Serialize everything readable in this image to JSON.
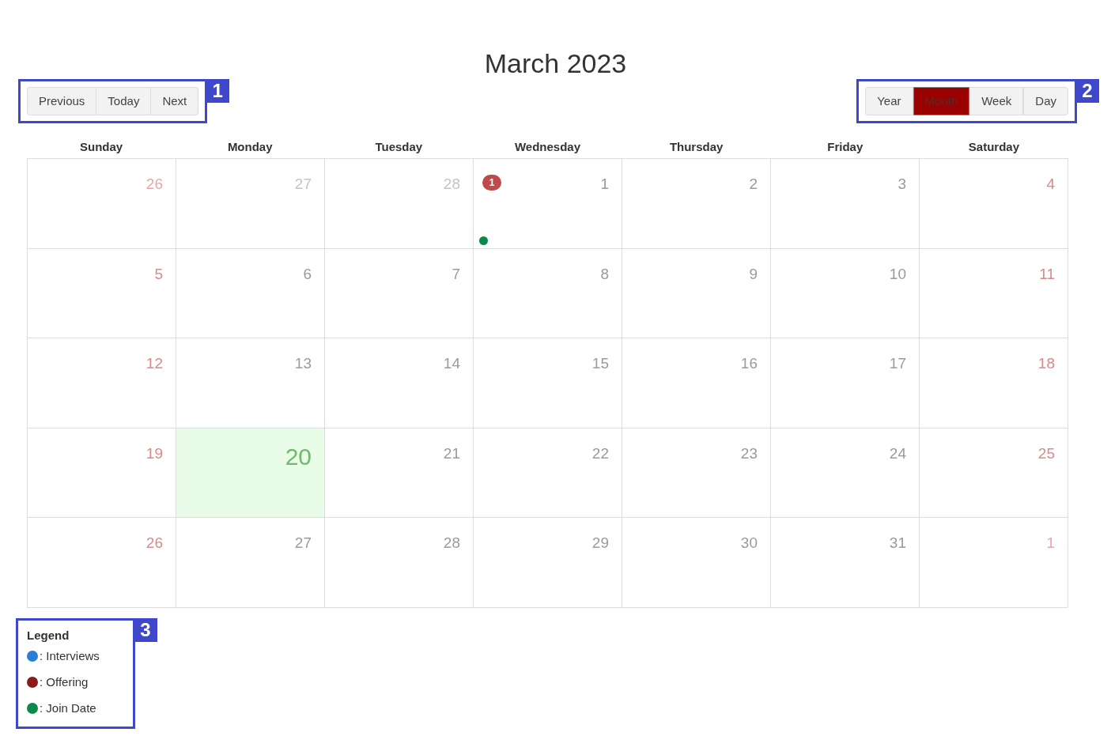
{
  "title": "March 2023",
  "nav_buttons": [
    {
      "label": "Previous"
    },
    {
      "label": "Today"
    },
    {
      "label": "Next"
    }
  ],
  "view_buttons": [
    {
      "label": "Year",
      "selected": false
    },
    {
      "label": "Month",
      "selected": true
    },
    {
      "label": "Week",
      "selected": false
    },
    {
      "label": "Day",
      "selected": false
    }
  ],
  "callouts": [
    "1",
    "2",
    "3"
  ],
  "weekdays": [
    "Sunday",
    "Monday",
    "Tuesday",
    "Wednesday",
    "Thursday",
    "Friday",
    "Saturday"
  ],
  "weeks": [
    [
      {
        "day": "26",
        "muted": true,
        "weekend": true
      },
      {
        "day": "27",
        "muted": true,
        "weekend": false
      },
      {
        "day": "28",
        "muted": true,
        "weekend": false
      },
      {
        "day": "1",
        "muted": false,
        "weekend": false,
        "badge": "1",
        "events": [
          {
            "color": "#0a8a4a"
          }
        ]
      },
      {
        "day": "2",
        "muted": false,
        "weekend": false
      },
      {
        "day": "3",
        "muted": false,
        "weekend": false
      },
      {
        "day": "4",
        "muted": false,
        "weekend": true
      }
    ],
    [
      {
        "day": "5",
        "muted": false,
        "weekend": true
      },
      {
        "day": "6",
        "muted": false,
        "weekend": false
      },
      {
        "day": "7",
        "muted": false,
        "weekend": false
      },
      {
        "day": "8",
        "muted": false,
        "weekend": false
      },
      {
        "day": "9",
        "muted": false,
        "weekend": false
      },
      {
        "day": "10",
        "muted": false,
        "weekend": false
      },
      {
        "day": "11",
        "muted": false,
        "weekend": true
      }
    ],
    [
      {
        "day": "12",
        "muted": false,
        "weekend": true
      },
      {
        "day": "13",
        "muted": false,
        "weekend": false
      },
      {
        "day": "14",
        "muted": false,
        "weekend": false
      },
      {
        "day": "15",
        "muted": false,
        "weekend": false
      },
      {
        "day": "16",
        "muted": false,
        "weekend": false
      },
      {
        "day": "17",
        "muted": false,
        "weekend": false
      },
      {
        "day": "18",
        "muted": false,
        "weekend": true
      }
    ],
    [
      {
        "day": "19",
        "muted": false,
        "weekend": true
      },
      {
        "day": "20",
        "today": true
      },
      {
        "day": "21",
        "muted": false,
        "weekend": false
      },
      {
        "day": "22",
        "muted": false,
        "weekend": false
      },
      {
        "day": "23",
        "muted": false,
        "weekend": false
      },
      {
        "day": "24",
        "muted": false,
        "weekend": false
      },
      {
        "day": "25",
        "muted": false,
        "weekend": true
      }
    ],
    [
      {
        "day": "26",
        "muted": false,
        "weekend": true
      },
      {
        "day": "27",
        "muted": false,
        "weekend": false
      },
      {
        "day": "28",
        "muted": false,
        "weekend": false
      },
      {
        "day": "29",
        "muted": false,
        "weekend": false
      },
      {
        "day": "30",
        "muted": false,
        "weekend": false
      },
      {
        "day": "31",
        "muted": false,
        "weekend": false
      },
      {
        "day": "1",
        "muted": true,
        "weekend": true
      }
    ]
  ],
  "legend": {
    "title": "Legend",
    "items": [
      {
        "label": ": Interviews",
        "color": "#2a7fd4"
      },
      {
        "label": ": Offering",
        "color": "#8b1a1a"
      },
      {
        "label": ": Join Date",
        "color": "#0a8a4a"
      }
    ]
  }
}
